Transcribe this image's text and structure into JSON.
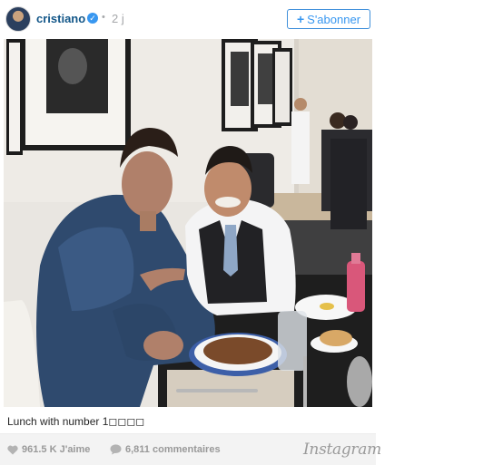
{
  "post": {
    "username": "cristiano",
    "dot": "•",
    "time_ago": "2 j",
    "follow_label": "S'abonner",
    "follow_plus": "+",
    "verified_mark": "✓",
    "caption": "Lunch with number 1◻◻◻◻",
    "likes": "961.5 K J'aime",
    "comments": "6,811 commentaires",
    "brand": "Instagram"
  },
  "icons": {
    "verified": "verified-badge-icon",
    "like": "heart-icon",
    "comment": "comment-bubble-icon",
    "follow": "plus-icon"
  },
  "colors": {
    "username": "#125688",
    "follow_accent": "#3897f0",
    "muted": "#a5a7aa",
    "footer_bg": "#f3f3f3"
  }
}
